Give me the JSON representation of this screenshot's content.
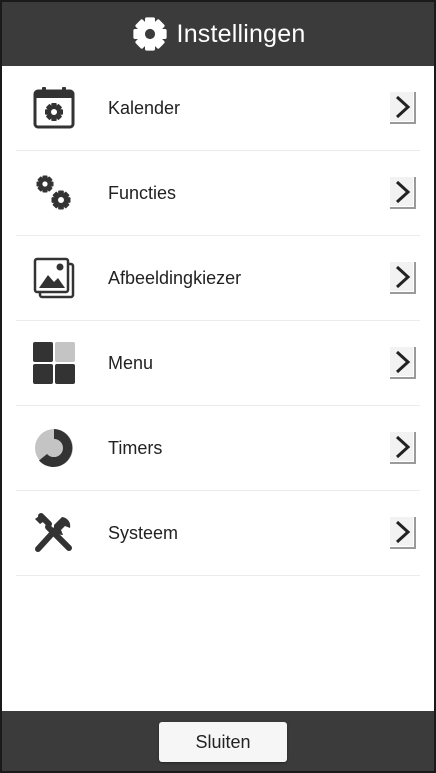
{
  "header": {
    "title": "Instellingen",
    "icon": "gear-icon"
  },
  "items": [
    {
      "label": "Kalender",
      "icon": "calendar-gear-icon"
    },
    {
      "label": "Functies",
      "icon": "gears-icon"
    },
    {
      "label": "Afbeeldingkiezer",
      "icon": "image-stack-icon"
    },
    {
      "label": "Menu",
      "icon": "menu-grid-icon"
    },
    {
      "label": "Timers",
      "icon": "timer-ring-icon"
    },
    {
      "label": "Systeem",
      "icon": "tools-icon"
    }
  ],
  "footer": {
    "close_label": "Sluiten"
  },
  "colors": {
    "header_background": "#3b3b3b",
    "header_text": "#ffffff",
    "row_text": "#222222",
    "divider": "#ececec",
    "icon_dark": "#333333",
    "icon_light": "#c4c4c4"
  }
}
